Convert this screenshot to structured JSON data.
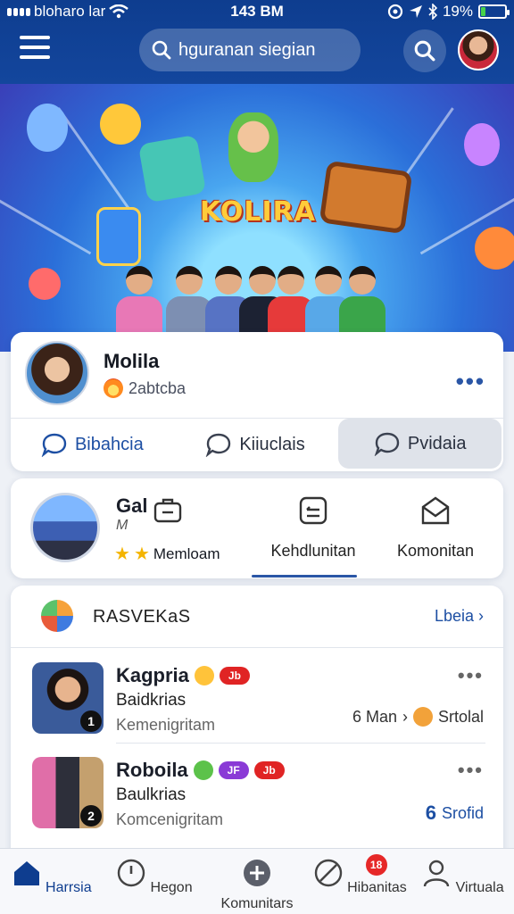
{
  "status_bar": {
    "carrier": "bloharo lar",
    "time": "143 BM",
    "battery": "19%",
    "battery_level": 0.19
  },
  "header": {
    "menu_icon": "hamburger-menu-icon",
    "search_placeholder": "hguranan siegian",
    "search_icon": "search-icon"
  },
  "hero": {
    "title": "KOLIRA"
  },
  "profile": {
    "name": "Molila",
    "subtitle": "2abtcba",
    "actions": [
      {
        "label": "Bibahcia",
        "icon": "chat-bubble-icon"
      },
      {
        "label": "Kiiuclais",
        "icon": "chat-bubble-icon"
      },
      {
        "label": "Pvidaia",
        "icon": "chat-bubble-icon"
      }
    ]
  },
  "group": {
    "title": "Gal",
    "subtitle": "M",
    "stars_label": "Memloam",
    "items": [
      {
        "label": "Kehdlunitan",
        "icon": "edit-box-icon"
      },
      {
        "label": "Komonitan",
        "icon": "envelope-icon"
      }
    ],
    "first_icon": "briefcase-icon"
  },
  "list": {
    "title": "RASVEKaS",
    "more_label": "Lbeia",
    "rows": [
      {
        "name": "Kagpria",
        "line2": "Baidkrias",
        "line3": "Kemenigritam",
        "badge": "1",
        "pill": "Jb",
        "meta": "6 Man",
        "meta2": "Srtolal"
      },
      {
        "name": "Roboila",
        "line2": "Baulkrias",
        "line3": "Komcenigritam",
        "badge": "2",
        "pill1": "JF",
        "pill2": "Jb",
        "meta": "Srofid",
        "meta_num": "6"
      }
    ]
  },
  "bottom_nav": [
    {
      "label": "Harrsia",
      "icon": "home-icon",
      "active": true
    },
    {
      "label": "Hegon",
      "icon": "clock-icon"
    },
    {
      "label": "Komunitars",
      "icon": "plus-circle-icon"
    },
    {
      "label": "Hibanitas",
      "icon": "compass-icon",
      "badge": "18"
    },
    {
      "label": "Virtuala",
      "icon": "user-icon"
    }
  ],
  "colors": {
    "header_bg": "#0e3d8f",
    "accent": "#1d4fa3",
    "badge_red": "#e62828"
  }
}
